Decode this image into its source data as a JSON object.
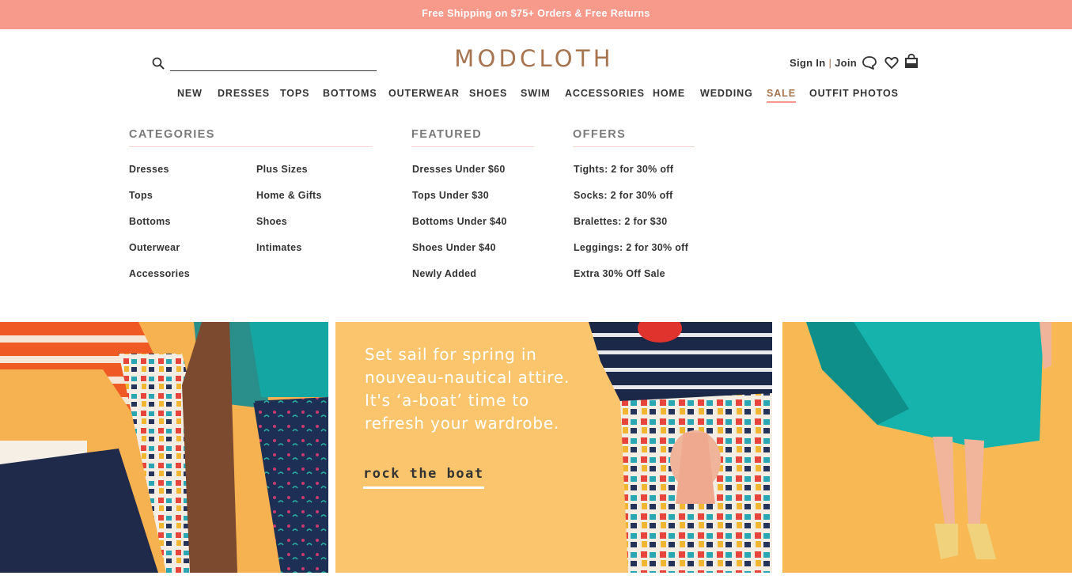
{
  "promo": {
    "text": "Free Shipping on $75+ Orders & Free Returns"
  },
  "search": {
    "placeholder": ""
  },
  "brand": {
    "logo": "MODCLOTH",
    "logo_color": "#a6744f",
    "accent_color": "#f89a8b"
  },
  "account": {
    "sign_in": "Sign In",
    "separator": "|",
    "join": "Join"
  },
  "header_icons": [
    "chat-icon",
    "heart-icon",
    "bag-icon"
  ],
  "nav": {
    "items": [
      "NEW",
      "DRESSES",
      "TOPS",
      "BOTTOMS",
      "OUTERWEAR",
      "SHOES",
      "SWIM",
      "ACCESSORIES",
      "HOME",
      "WEDDING",
      "SALE",
      "OUTFIT PHOTOS"
    ],
    "active": "SALE"
  },
  "dropdown": {
    "categories": {
      "heading": "CATEGORIES",
      "col1": [
        "Dresses",
        "Tops",
        "Bottoms",
        "Outerwear",
        "Accessories"
      ],
      "col2": [
        "Plus Sizes",
        "Home & Gifts",
        "Shoes",
        "Intimates"
      ]
    },
    "featured": {
      "heading": "FEATURED",
      "items": [
        "Dresses Under $60",
        "Tops Under $30",
        "Bottoms Under $40",
        "Shoes Under $40",
        "Newly Added"
      ]
    },
    "offers": {
      "heading": "OFFERS",
      "items": [
        "Tights: 2 for 30% off",
        "Socks: 2 for 30% off",
        "Bralettes: 2 for $30",
        "Leggings: 2 for 30% off",
        "Extra 30% Off Sale"
      ]
    }
  },
  "hero": {
    "lines": [
      "Set sail for spring in",
      "nouveau-nautical attire.",
      "It's ‘a-boat’ time to",
      "refresh your wardrobe."
    ],
    "cta": "rock the boat"
  }
}
